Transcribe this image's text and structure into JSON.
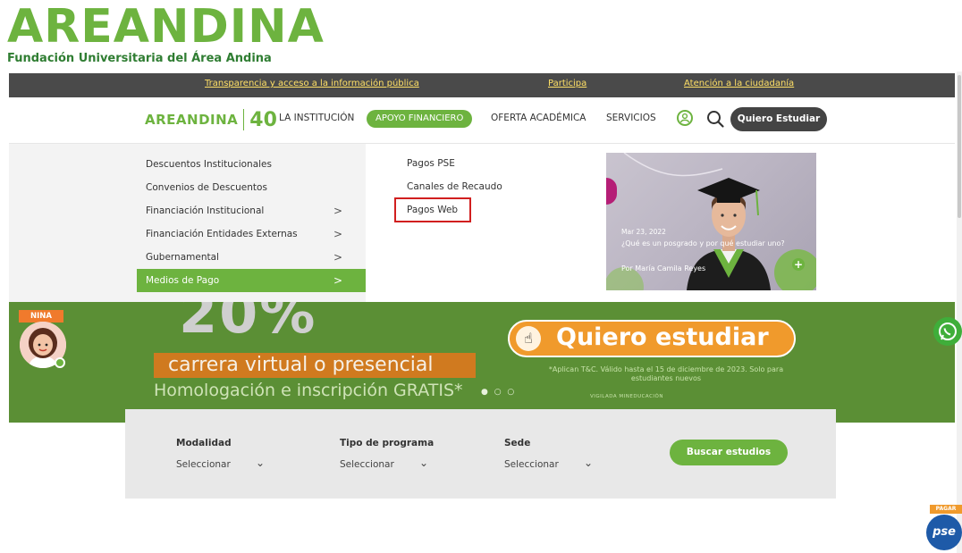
{
  "brand": {
    "wordmark": "AREANDINA",
    "tagline": "Fundación Universitaria del Área Andina"
  },
  "topbar": {
    "links": [
      "Transparencia y acceso a la información pública",
      "Participa",
      "Atención a la ciudadanía"
    ]
  },
  "nav": {
    "logo_word": "AREANDINA",
    "logo_number": "40",
    "items": [
      "LA INSTITUCIÓN",
      "APOYO FINANCIERO",
      "OFERTA ACADÉMICA",
      "SERVICIOS"
    ],
    "cta": "Quiero Estudiar"
  },
  "mega": {
    "left_items": [
      {
        "label": "Descuentos Institucionales",
        "chevron": ""
      },
      {
        "label": "Convenios de Descuentos",
        "chevron": ""
      },
      {
        "label": "Financiación Institucional",
        "chevron": ">"
      },
      {
        "label": "Financiación Entidades Externas",
        "chevron": ">"
      },
      {
        "label": "Gubernamental",
        "chevron": ">"
      },
      {
        "label": "Medios de Pago",
        "chevron": ">"
      }
    ],
    "sub_items": [
      "Pagos PSE",
      "Canales de Recaudo",
      "Pagos Web"
    ],
    "card": {
      "date": "Mar 23, 2022",
      "title": "¿Qué es un posgrado y por qué estudiar uno?",
      "author": "Por María Camila Reyes",
      "plus": "+"
    }
  },
  "hero": {
    "big_text": "20%",
    "cta": "Quiero estudiar",
    "carrera": "carrera virtual o presencial",
    "homologacion": "Homologación e inscripción GRATIS*",
    "dots": "● ○ ○",
    "fine_print": "*Aplican T&C. Válido hasta el 15 de diciembre de 2023. Solo para estudiantes nuevos",
    "vigilada": "VIGILADA MINEDUCACIÓN"
  },
  "nina": {
    "label": "NINA"
  },
  "search": {
    "fields": [
      {
        "label": "Modalidad",
        "value": "Seleccionar"
      },
      {
        "label": "Tipo de programa",
        "value": "Seleccionar"
      },
      {
        "label": "Sede",
        "value": "Seleccionar"
      }
    ],
    "button": "Buscar estudios"
  },
  "pse": {
    "tag": "PAGAR",
    "logo": "pse"
  },
  "colors": {
    "brand_green": "#6db33f",
    "dark_bar": "#4a4a4a",
    "hero_green": "#5b8f35",
    "orange": "#f09a2c",
    "highlight_red": "#d11f1f"
  }
}
